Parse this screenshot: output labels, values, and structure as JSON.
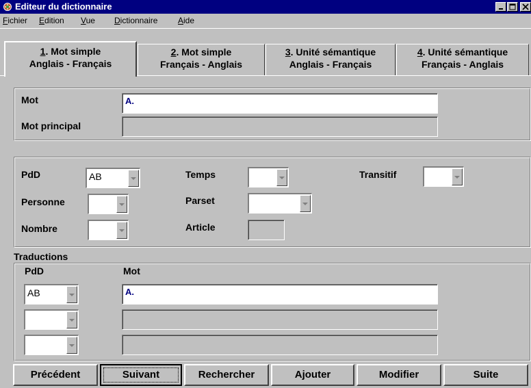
{
  "window": {
    "title": "Editeur du dictionnaire",
    "icon": "app-icon",
    "controls": [
      "minimize-icon",
      "maximize-icon",
      "close-icon"
    ]
  },
  "menu": {
    "items": [
      {
        "mnemonic": "F",
        "rest": "ichier"
      },
      {
        "mnemonic": "E",
        "rest": "dition"
      },
      {
        "mnemonic": "V",
        "rest": "ue"
      },
      {
        "mnemonic": "D",
        "rest": "ictionnaire"
      },
      {
        "mnemonic": "A",
        "rest": "ide"
      }
    ]
  },
  "tabs": [
    {
      "num": "1",
      "title": ". Mot simple",
      "subtitle": "Anglais - Français",
      "active": true
    },
    {
      "num": "2",
      "title": ". Mot simple",
      "subtitle": "Français - Anglais",
      "active": false
    },
    {
      "num": "3",
      "title": ". Unité sémantique",
      "subtitle": "Anglais - Français",
      "active": false
    },
    {
      "num": "4",
      "title": ". Unité sémantique",
      "subtitle": "Français - Anglais",
      "active": false
    }
  ],
  "word_panel": {
    "mot_label": "Mot",
    "mot_value": "A.",
    "mot_principal_label": "Mot principal",
    "mot_principal_value": ""
  },
  "attributes": {
    "pdd_label": "PdD",
    "pdd_value": "AB",
    "personne_label": "Personne",
    "personne_value": "",
    "nombre_label": "Nombre",
    "nombre_value": "",
    "temps_label": "Temps",
    "temps_value": "",
    "parset_label": "Parset",
    "parset_value": "",
    "article_label": "Article",
    "article_value": "",
    "transitif_label": "Transitif",
    "transitif_value": ""
  },
  "translations": {
    "title": "Traductions",
    "pdd_header": "PdD",
    "mot_header": "Mot",
    "rows": [
      {
        "pdd": "AB",
        "mot": "A."
      },
      {
        "pdd": "",
        "mot": ""
      },
      {
        "pdd": "",
        "mot": ""
      }
    ]
  },
  "buttons": {
    "precedent": "Précédent",
    "suivant": "Suivant",
    "rechercher": "Rechercher",
    "ajouter": "Ajouter",
    "modifier": "Modifier",
    "suite": "Suite"
  }
}
